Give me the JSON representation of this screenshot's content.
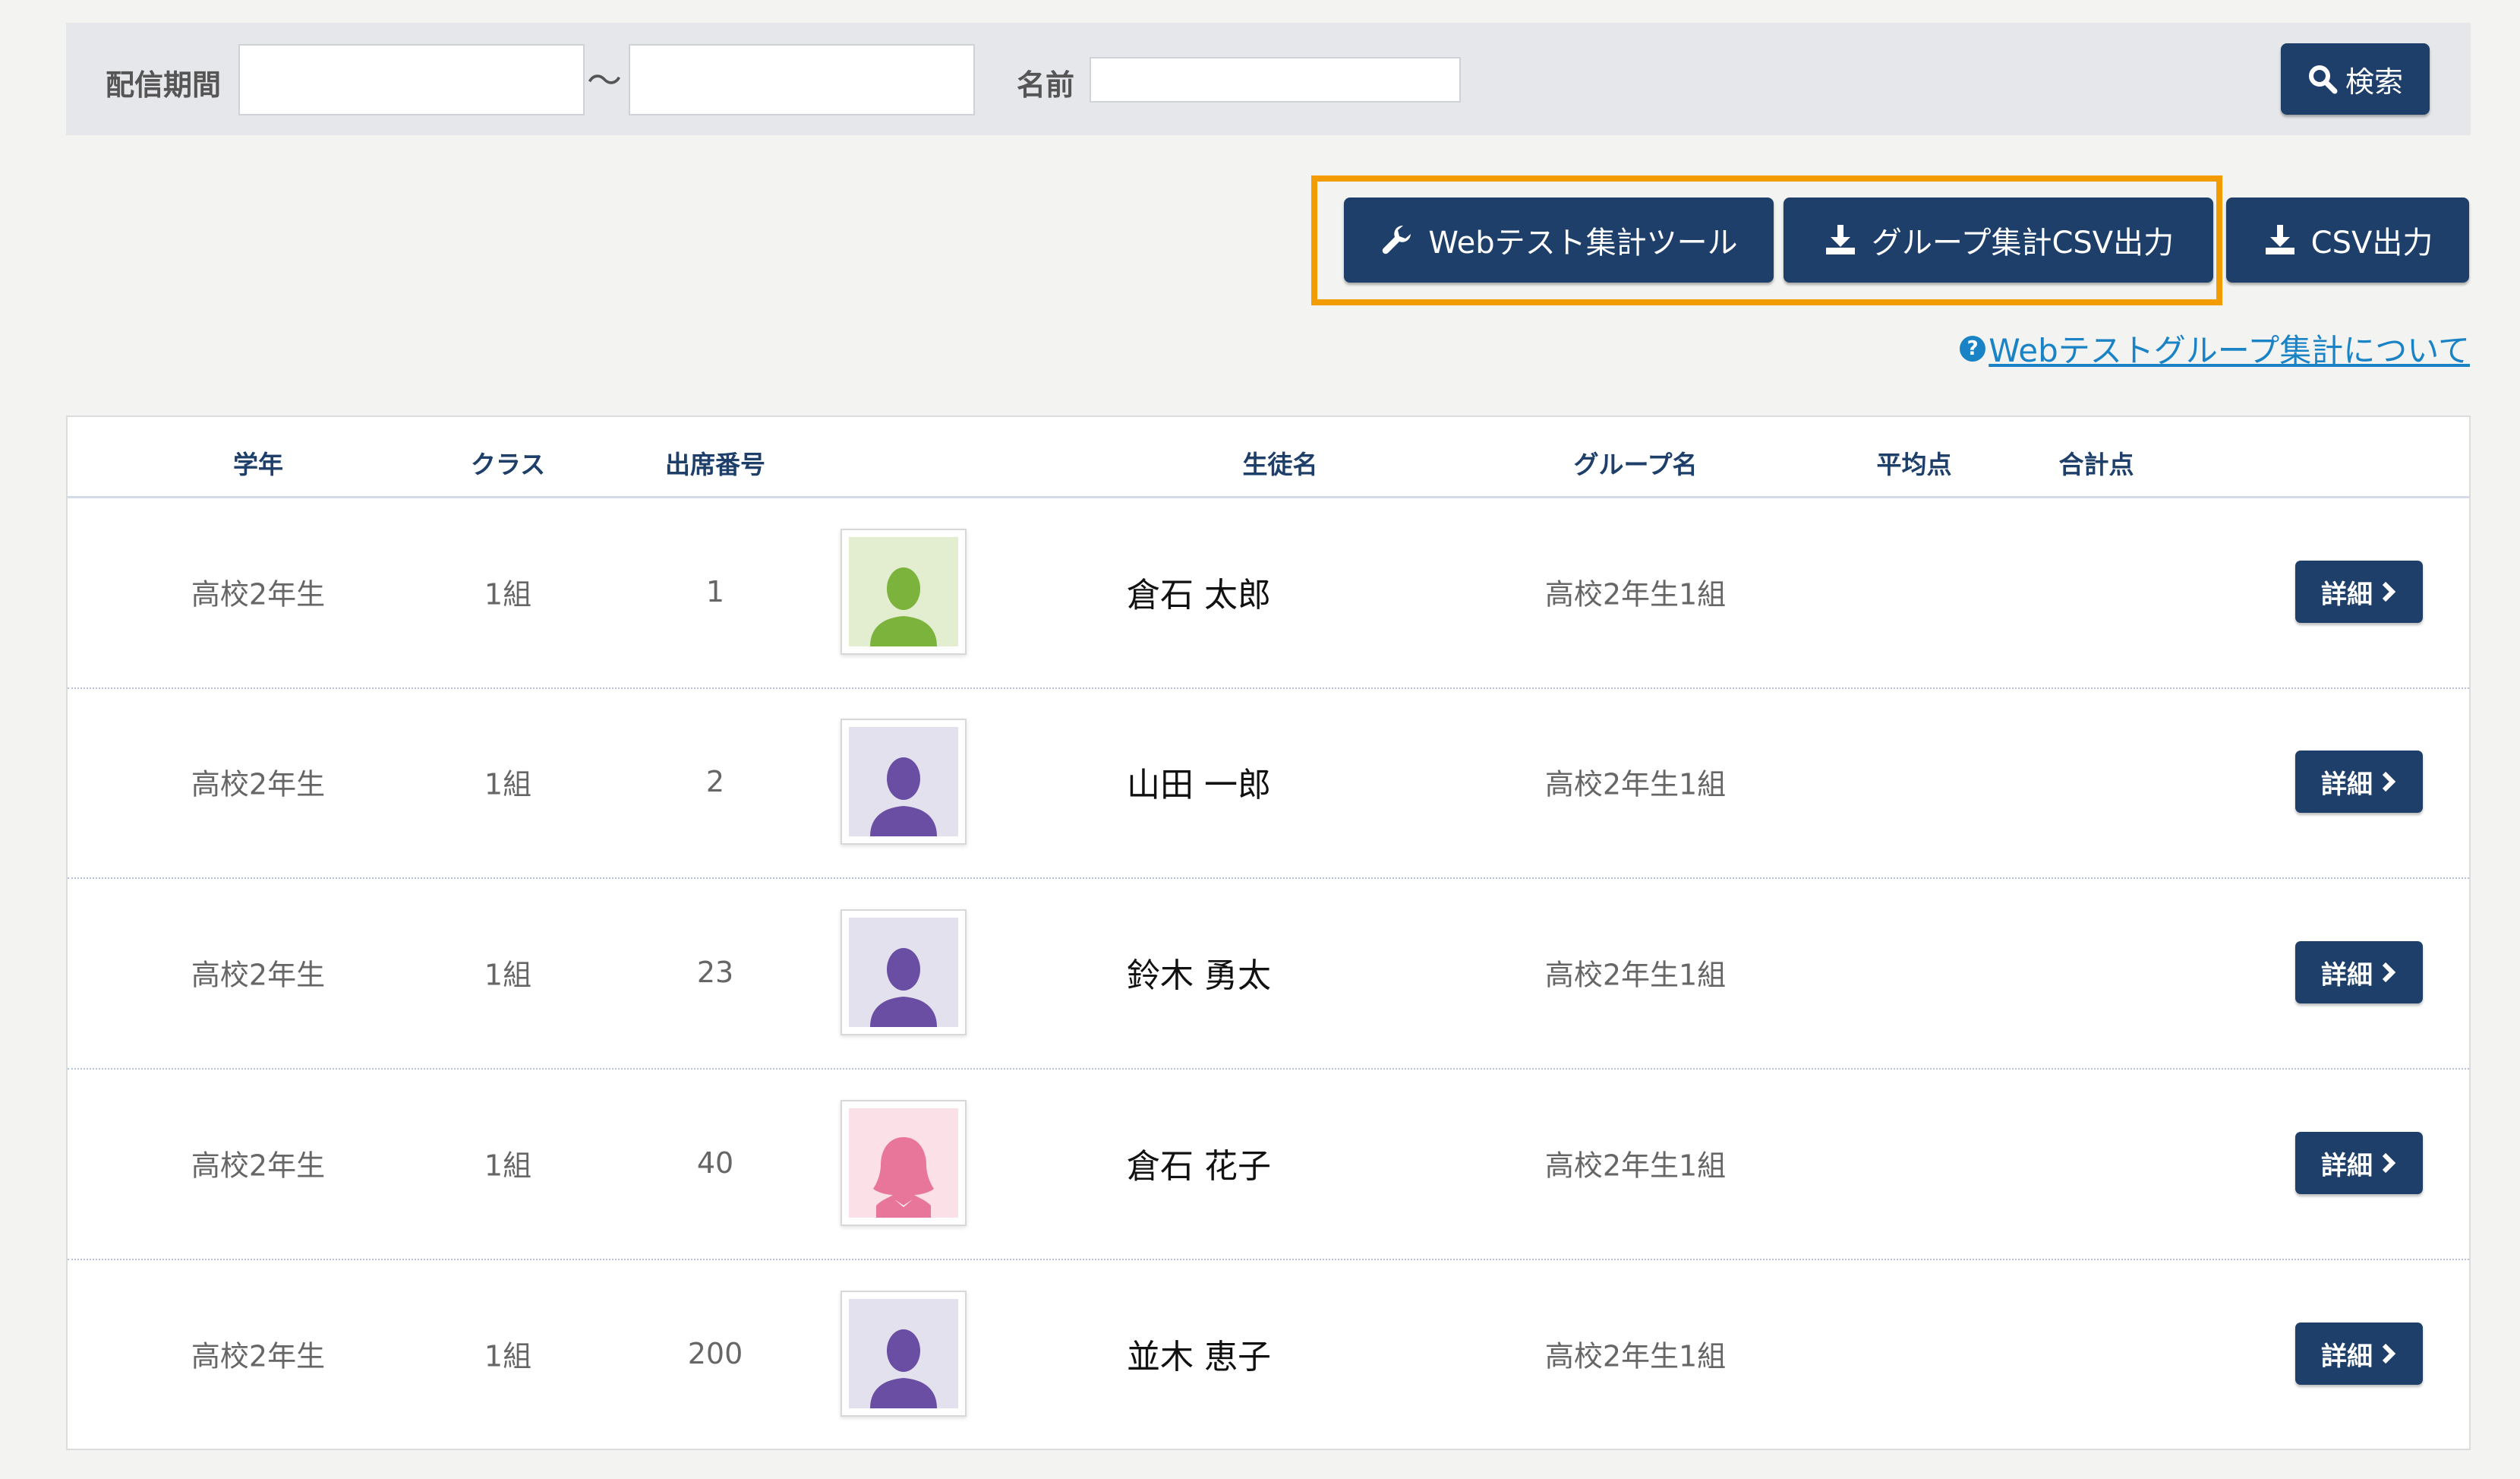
{
  "filters": {
    "period_label": "配信期間",
    "period_from": "",
    "period_to": "",
    "tilde": "〜",
    "name_label": "名前",
    "name_value": "",
    "search_label": "検索"
  },
  "actions": {
    "web_test_tool": "Webテスト集計ツール",
    "group_csv": "グループ集計CSV出力",
    "csv": "CSV出力",
    "help_link": "Webテストグループ集計について",
    "highlight_color": "#f39c00"
  },
  "table": {
    "headers": {
      "grade": "学年",
      "class": "クラス",
      "number": "出席番号",
      "student_name": "生徒名",
      "group_name": "グループ名",
      "average": "平均点",
      "total": "合計点"
    },
    "rows": [
      {
        "grade": "高校2年生",
        "class": "1組",
        "number": "1",
        "name": "倉石 太郎",
        "group": "高校2年生1組",
        "avatar": "green-male-avatar-icon",
        "detail": "詳細"
      },
      {
        "grade": "高校2年生",
        "class": "1組",
        "number": "2",
        "name": "山田 一郎",
        "group": "高校2年生1組",
        "avatar": "purple-avatar-icon",
        "detail": "詳細"
      },
      {
        "grade": "高校2年生",
        "class": "1組",
        "number": "23",
        "name": "鈴木 勇太",
        "group": "高校2年生1組",
        "avatar": "purple-avatar-icon",
        "detail": "詳細"
      },
      {
        "grade": "高校2年生",
        "class": "1組",
        "number": "40",
        "name": "倉石 花子",
        "group": "高校2年生1組",
        "avatar": "pink-female-avatar-icon",
        "detail": "詳細"
      },
      {
        "grade": "高校2年生",
        "class": "1組",
        "number": "200",
        "name": "並木 恵子",
        "group": "高校2年生1組",
        "avatar": "purple-avatar-icon",
        "detail": "詳細"
      }
    ]
  },
  "colors": {
    "primary_button": "#1e3f6a",
    "header_text": "#1e3f6a",
    "link": "#1a83c6"
  }
}
